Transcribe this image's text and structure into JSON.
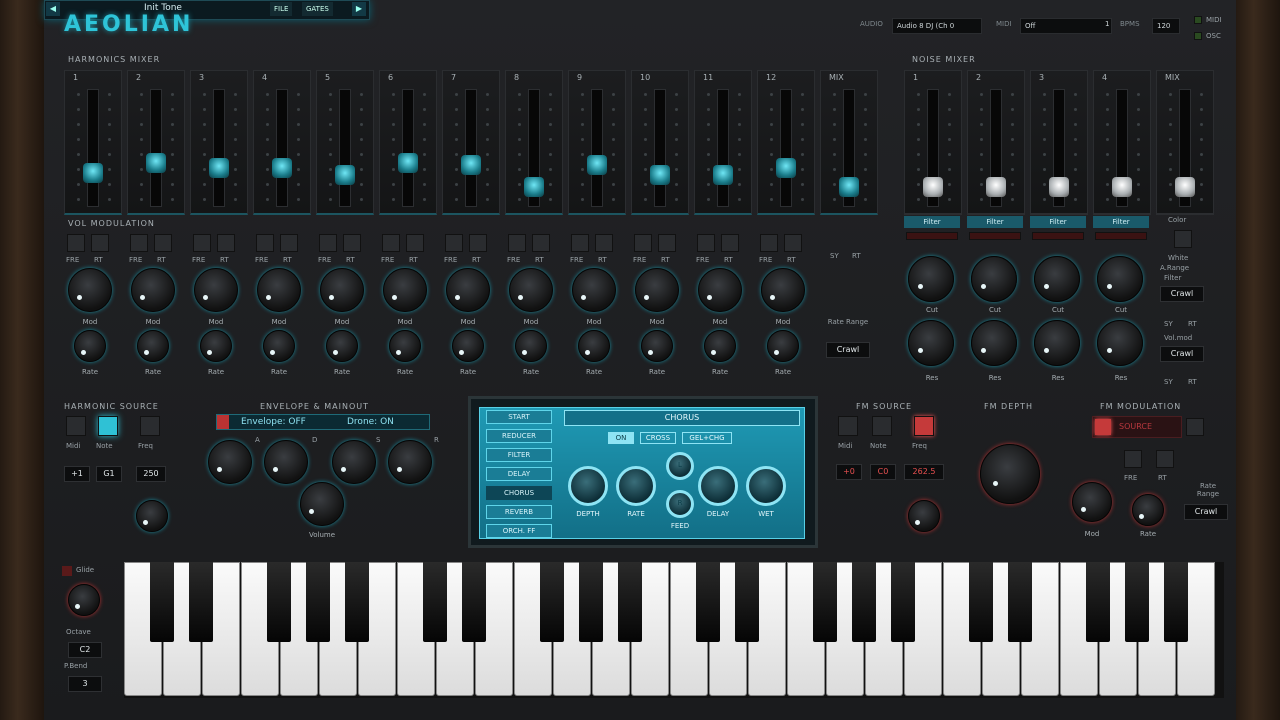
{
  "header": {
    "logo": "AEOLIAN",
    "preset": "Init Tone",
    "file": "FILE",
    "gates": "GATES",
    "audio_label": "AUDIO",
    "audio_value": "Audio 8 DJ (Ch 0",
    "midi_label": "MIDI",
    "midi_value": "Off",
    "midi_ch": "1",
    "bpm_label": "BPMS",
    "bpm_value": "120",
    "midi_ind": "MIDI",
    "osc_ind": "OSC"
  },
  "harmonics": {
    "title": "HARMONICS MIXER",
    "channels": [
      "1",
      "2",
      "3",
      "4",
      "5",
      "6",
      "7",
      "8",
      "9",
      "10",
      "11",
      "12",
      "MIX"
    ],
    "levels": [
      0.25,
      0.35,
      0.3,
      0.3,
      0.22,
      0.35,
      0.33,
      0.1,
      0.33,
      0.22,
      0.22,
      0.3,
      0.1
    ]
  },
  "noise": {
    "title": "NOISE MIXER",
    "channels": [
      "1",
      "2",
      "3",
      "4",
      "MIX"
    ],
    "levels": [
      0.1,
      0.1,
      0.1,
      0.1,
      0.1
    ],
    "filter": "Filter",
    "cut": "Cut",
    "res": "Res",
    "color": "Color",
    "white": "White",
    "arange": "A.Range",
    "filter2": "Filter",
    "crawl": "Crawl",
    "volmod": "Vol.mod",
    "sy": "SY",
    "rt": "RT"
  },
  "volmod": {
    "title": "VOL MODULATION",
    "fre": "FRE",
    "rt": "RT",
    "mod": "Mod",
    "rate": "Rate",
    "sy": "SY",
    "rate_range": "Rate Range",
    "crawl": "Crawl"
  },
  "hsource": {
    "title": "HARMONIC SOURCE",
    "midi": "Midi",
    "note": "Note",
    "freq": "Freq",
    "v1": "+1",
    "v2": "G1",
    "v3": "250"
  },
  "envelope": {
    "title": "ENVELOPE & MAINOUT",
    "env": "Envelope: OFF",
    "drone": "Drone: ON",
    "a": "A",
    "d": "D",
    "s": "S",
    "r": "R",
    "volume": "Volume"
  },
  "fx": {
    "tabs": [
      "START",
      "REDUCER",
      "FILTER",
      "DELAY",
      "CHORUS",
      "REVERB",
      "ORCH. FF"
    ],
    "title": "CHORUS",
    "modes": [
      "ON",
      "CROSS",
      "GEL+CHG"
    ],
    "knobs": [
      "DEPTH",
      "RATE",
      "L",
      "R",
      "DELAY",
      "WET"
    ],
    "feed": "FEED"
  },
  "fmsource": {
    "title": "FM SOURCE",
    "midi": "Midi",
    "note": "Note",
    "freq": "Freq",
    "v1": "+0",
    "v2": "C0",
    "v3": "262.5"
  },
  "fmdepth": {
    "title": "FM DEPTH"
  },
  "fmmod": {
    "title": "FM MODULATION",
    "src": "SOURCE",
    "fre": "FRE",
    "rt": "RT",
    "mod": "Mod",
    "rate": "Rate",
    "rate_range": "Rate Range",
    "crawl": "Crawl"
  },
  "keyboard": {
    "glide": "Glide",
    "octave": "Octave",
    "octave_val": "C2",
    "pbend": "P.Bend",
    "pbend_val": "3"
  }
}
